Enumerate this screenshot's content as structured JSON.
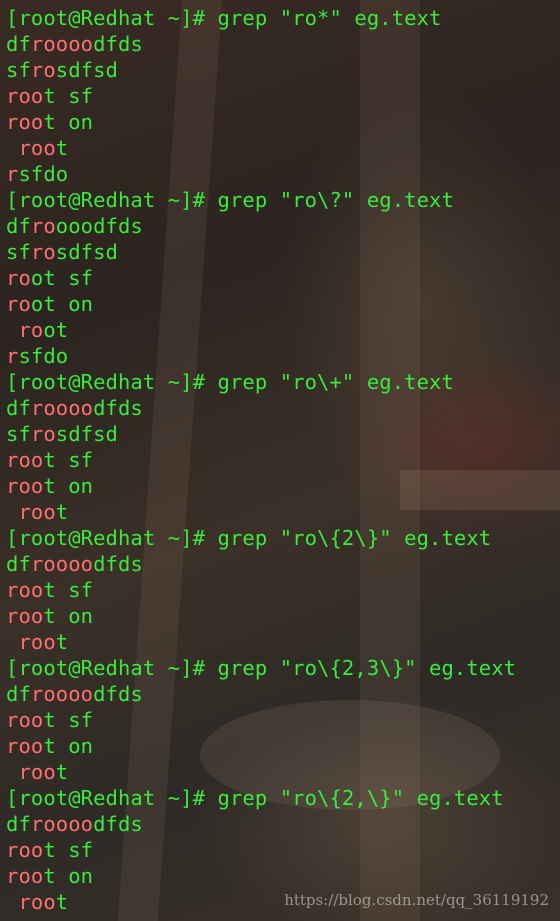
{
  "terminal": {
    "colors": {
      "default_text": "#3bea3b",
      "match_highlight": "#ff6f6f"
    },
    "lines": [
      [
        {
          "t": "[root@Redhat ~]# grep \"ro*\" eg.text"
        }
      ],
      [
        {
          "t": "df"
        },
        {
          "t": "roooo",
          "m": true
        },
        {
          "t": "dfds"
        }
      ],
      [
        {
          "t": "sf"
        },
        {
          "t": "ro",
          "m": true
        },
        {
          "t": "sdfsd"
        }
      ],
      [
        {
          "t": "roo",
          "m": true
        },
        {
          "t": "t sf"
        }
      ],
      [
        {
          "t": "roo",
          "m": true
        },
        {
          "t": "t on"
        }
      ],
      [
        {
          "t": " "
        },
        {
          "t": "roo",
          "m": true
        },
        {
          "t": "t"
        }
      ],
      [
        {
          "t": "r",
          "m": true
        },
        {
          "t": "sfdo"
        }
      ],
      [
        {
          "t": "[root@Redhat ~]# grep \"ro\\?\" eg.text"
        }
      ],
      [
        {
          "t": "df"
        },
        {
          "t": "ro",
          "m": true
        },
        {
          "t": "ooodfds"
        }
      ],
      [
        {
          "t": "sf"
        },
        {
          "t": "ro",
          "m": true
        },
        {
          "t": "sdfsd"
        }
      ],
      [
        {
          "t": "ro",
          "m": true
        },
        {
          "t": "ot sf"
        }
      ],
      [
        {
          "t": "ro",
          "m": true
        },
        {
          "t": "ot on"
        }
      ],
      [
        {
          "t": " "
        },
        {
          "t": "ro",
          "m": true
        },
        {
          "t": "ot"
        }
      ],
      [
        {
          "t": "r",
          "m": true
        },
        {
          "t": "sfdo"
        }
      ],
      [
        {
          "t": "[root@Redhat ~]# grep \"ro\\+\" eg.text"
        }
      ],
      [
        {
          "t": "df"
        },
        {
          "t": "roooo",
          "m": true
        },
        {
          "t": "dfds"
        }
      ],
      [
        {
          "t": "sf"
        },
        {
          "t": "ro",
          "m": true
        },
        {
          "t": "sdfsd"
        }
      ],
      [
        {
          "t": "roo",
          "m": true
        },
        {
          "t": "t sf"
        }
      ],
      [
        {
          "t": "roo",
          "m": true
        },
        {
          "t": "t on"
        }
      ],
      [
        {
          "t": " "
        },
        {
          "t": "roo",
          "m": true
        },
        {
          "t": "t"
        }
      ],
      [
        {
          "t": "[root@Redhat ~]# grep \"ro\\{2\\}\" eg.text"
        }
      ],
      [
        {
          "t": "df"
        },
        {
          "t": "roooo",
          "m": true
        },
        {
          "t": "dfds"
        }
      ],
      [
        {
          "t": "roo",
          "m": true
        },
        {
          "t": "t sf"
        }
      ],
      [
        {
          "t": "roo",
          "m": true
        },
        {
          "t": "t on"
        }
      ],
      [
        {
          "t": " "
        },
        {
          "t": "roo",
          "m": true
        },
        {
          "t": "t"
        }
      ],
      [
        {
          "t": "[root@Redhat ~]# grep \"ro\\{2,3\\}\" eg.text"
        }
      ],
      [
        {
          "t": "df"
        },
        {
          "t": "roooo",
          "m": true
        },
        {
          "t": "dfds"
        }
      ],
      [
        {
          "t": "roo",
          "m": true
        },
        {
          "t": "t sf"
        }
      ],
      [
        {
          "t": "roo",
          "m": true
        },
        {
          "t": "t on"
        }
      ],
      [
        {
          "t": " "
        },
        {
          "t": "roo",
          "m": true
        },
        {
          "t": "t"
        }
      ],
      [
        {
          "t": "[root@Redhat ~]# grep \"ro\\{2,\\}\" eg.text"
        }
      ],
      [
        {
          "t": "df"
        },
        {
          "t": "roooo",
          "m": true
        },
        {
          "t": "dfds"
        }
      ],
      [
        {
          "t": "roo",
          "m": true
        },
        {
          "t": "t sf"
        }
      ],
      [
        {
          "t": "roo",
          "m": true
        },
        {
          "t": "t on"
        }
      ],
      [
        {
          "t": " "
        },
        {
          "t": "roo",
          "m": true
        },
        {
          "t": "t"
        }
      ]
    ]
  },
  "watermark": "https://blog.csdn.net/qq_36119192"
}
